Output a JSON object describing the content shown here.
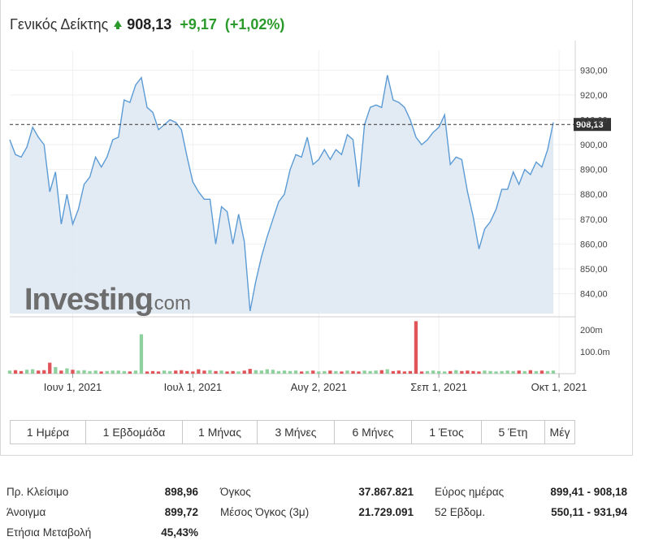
{
  "header": {
    "title": "Γενικός Δείκτης",
    "price": "908,13",
    "change": "+9,17",
    "change_pct": "(+1,02%)",
    "up_color": "#2a9b2a"
  },
  "watermark": {
    "brand": "Investing",
    "suffix": ".com"
  },
  "chart_data": {
    "type": "area",
    "y_ticks": [
      "930,00",
      "920,00",
      "910,00",
      "900,00",
      "890,00",
      "880,00",
      "870,00",
      "860,00",
      "850,00",
      "840,00"
    ],
    "ylim": [
      832,
      936
    ],
    "last_label": "908,13",
    "last_value": 908.13,
    "x_ticks": [
      "Ιουν 1, 2021",
      "Ιουλ 1, 2021",
      "Αυγ 2, 2021",
      "Σεπ 1, 2021",
      "Οκτ 1, 2021"
    ],
    "x_tick_index": [
      11,
      32,
      54,
      75,
      96
    ],
    "close": [
      902,
      896,
      895,
      899,
      907,
      903,
      900,
      881,
      889,
      868,
      880,
      868,
      874,
      884,
      887,
      895,
      891,
      895,
      902,
      903,
      918,
      917,
      924,
      927,
      915,
      913,
      906,
      908,
      910,
      909,
      906,
      895,
      885,
      881,
      878,
      878,
      860,
      875,
      873,
      860,
      872,
      861,
      833,
      845,
      855,
      863,
      870,
      877,
      880,
      890,
      896,
      895,
      903,
      892,
      894,
      898,
      894,
      898,
      896,
      904,
      902,
      883,
      908,
      915,
      916,
      915,
      928,
      918,
      917,
      915,
      910,
      903,
      900,
      902,
      905,
      907,
      912,
      892,
      895,
      894,
      881,
      871,
      858,
      866,
      869,
      874,
      882,
      882,
      889,
      884,
      890,
      888,
      893,
      891,
      898,
      909
    ],
    "volume_ticks": [
      "200m",
      "100.0m"
    ],
    "volume_max": 260,
    "volume": [
      14,
      16,
      12,
      18,
      20,
      14,
      16,
      50,
      30,
      14,
      24,
      18,
      14,
      16,
      12,
      14,
      10,
      12,
      14,
      14,
      12,
      10,
      14,
      12,
      10,
      12,
      10,
      14,
      12,
      14,
      16,
      12,
      10,
      20,
      14,
      16,
      12,
      14,
      10,
      12,
      10,
      14,
      22,
      16,
      14,
      20,
      18,
      12,
      14,
      12,
      14,
      10,
      12,
      14,
      10,
      12,
      14,
      12,
      10,
      14,
      12,
      10,
      14,
      12,
      14,
      16,
      20,
      12,
      14,
      10,
      12,
      14,
      10,
      12,
      14,
      12,
      10,
      12,
      16,
      12,
      14,
      12,
      10,
      14,
      12,
      10,
      12,
      14,
      12,
      14,
      12,
      16,
      12,
      14,
      12,
      14
    ],
    "volume_special": {
      "23": 180,
      "71": 240
    },
    "volume_colors": [
      "red",
      "green"
    ],
    "line_color": "#5b9bd5",
    "fill_color": "#dde8f2",
    "grid": true
  },
  "timeframes": [
    "1 Ημέρα",
    "1 Εβδομάδα",
    "1 Μήνας",
    "3 Μήνες",
    "6 Μήνες",
    "1 Έτος",
    "5 Έτη",
    "Μέγ"
  ],
  "stats": {
    "prev_close_label": "Πρ. Κλείσιμο",
    "prev_close": "898,96",
    "open_label": "Άνοιγμα",
    "open": "899,72",
    "yearly_label": "Ετήσια Μεταβολή",
    "yearly": "45,43%",
    "volume_label": "Όγκος",
    "volume": "37.867.821",
    "avg_volume_label": "Μέσος Όγκος (3μ)",
    "avg_volume": "21.729.091",
    "day_range_label": "Εύρος ημέρας",
    "day_range": "899,41 - 908,18",
    "week52_label": "52 Εβδομ.",
    "week52": "550,11 - 931,94"
  }
}
